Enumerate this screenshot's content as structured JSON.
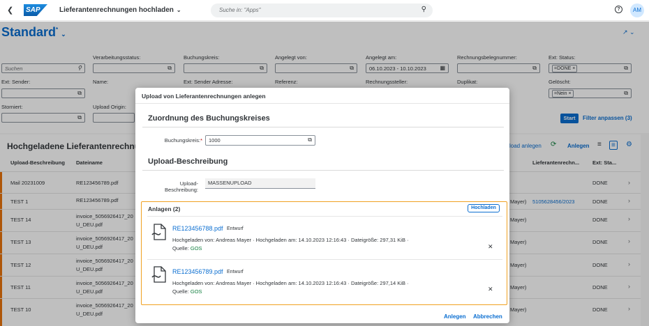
{
  "shell": {
    "back_icon": "back-icon",
    "logo": "SAP",
    "app_title": "Lieferantenrechnungen hochladen",
    "search_placeholder": "Suche in: \"Apps\"",
    "avatar": "AM"
  },
  "variant": {
    "name": "Standard",
    "modified": "*"
  },
  "filters": {
    "search_placeholder": "Suchen",
    "labels": {
      "verarbeitungsstatus": "Verarbeitungsstatus:",
      "buchungskreis": "Buchungskreis:",
      "angelegt_von": "Angelegt von:",
      "angelegt_am": "Angelegt am:",
      "rechnungsbelegnummer": "Rechnungsbelegnummer:",
      "ext_status": "Ext: Status:",
      "ext_sender": "Ext: Sender:",
      "name": "Name:",
      "ext_sender_adresse": "Ext: Sender Adresse:",
      "referenz": "Referenz:",
      "rechnungssteller": "Rechnungssteller:",
      "duplikat": "Duplikat:",
      "geloescht": "Gelöscht:",
      "storniert": "Storniert:",
      "upload_origin": "Upload Origin:"
    },
    "angelegt_am_value": "06.10.2023 - 10.10.2023",
    "ext_status_token": "=DONE",
    "geloescht_token": "=Nein",
    "start": "Start",
    "adapt": "Filter anpassen (3)"
  },
  "table": {
    "title": "Hochgeladene Lieferantenrechnu",
    "toolbar": {
      "upload": "load anlegen",
      "create": "Anlegen"
    },
    "columns": {
      "beschreibung": "Upload-Beschreibung",
      "dateiname": "Dateiname",
      "rechnungsnr": "Lieferantenrechn...",
      "ext_status": "Ext: Sta..."
    },
    "rows": [
      {
        "desc": "Mail 20231009",
        "file1": "RE123456789.pdf",
        "file2": "",
        "mid": "",
        "invoice": "",
        "status": "DONE"
      },
      {
        "desc": "TEST 1",
        "file1": "RE123456789.pdf",
        "file2": "",
        "mid": "Mayer)",
        "invoice": "5105628456/2023",
        "status": "DONE"
      },
      {
        "desc": "TEST 14",
        "file1": "invoice_5056926417_20",
        "file2": "U_DEU.pdf",
        "mid": "Mayer)",
        "invoice": "",
        "status": "DONE"
      },
      {
        "desc": "TEST 13",
        "file1": "invoice_5056926417_20",
        "file2": "U_DEU.pdf",
        "mid": "Mayer)",
        "invoice": "",
        "status": "DONE"
      },
      {
        "desc": "TEST 12",
        "file1": "invoice_5056926417_20",
        "file2": "U_DEU.pdf",
        "mid": "Mayer)",
        "invoice": "",
        "status": "DONE"
      },
      {
        "desc": "TEST 11",
        "file1": "invoice_5056926417_20",
        "file2": "U_DEU.pdf",
        "mid": "Mayer)",
        "invoice": "",
        "status": "DONE"
      },
      {
        "desc": "TEST 10",
        "file1": "invoice_5056926417_20",
        "file2": "U_DEU.pdf",
        "mid": "Mayer)",
        "invoice": "",
        "status": "DONE"
      }
    ]
  },
  "dialog": {
    "title": "Upload von Lieferantenrechnungen anlegen",
    "section1": "Zuordnung des Buchungskreises",
    "buchungskreis_label": "Buchungskreis:",
    "buchungskreis_value": "1000",
    "section2": "Upload-Beschreibung",
    "beschreibung_label1": "Upload-",
    "beschreibung_label2": "Beschreibung:",
    "beschreibung_value": "MASSENUPLOAD",
    "attachments": {
      "title": "Anlagen (2)",
      "upload_button": "Hochladen",
      "items": [
        {
          "name": "RE123456788.pdf",
          "status": "Entwurf",
          "meta": "Hochgeladen von: Andreas Mayer · Hochgeladen am: 14.10.2023 12:16:43 · Dateigröße: 297,31 KiB ·",
          "source_label": "Quelle:",
          "source": "GOS"
        },
        {
          "name": "RE123456789.pdf",
          "status": "Entwurf",
          "meta": "Hochgeladen von: Andreas Mayer · Hochgeladen am: 14.10.2023 12:16:43 · Dateigröße: 297,14 KiB ·",
          "source_label": "Quelle:",
          "source": "GOS"
        }
      ]
    },
    "footer": {
      "create": "Anlegen",
      "cancel": "Abbrechen"
    }
  },
  "colors": {
    "accent": "#0a6ed1",
    "highlight": "#f0a020",
    "row_marker": "#e9730c",
    "source": "#107e3e"
  }
}
